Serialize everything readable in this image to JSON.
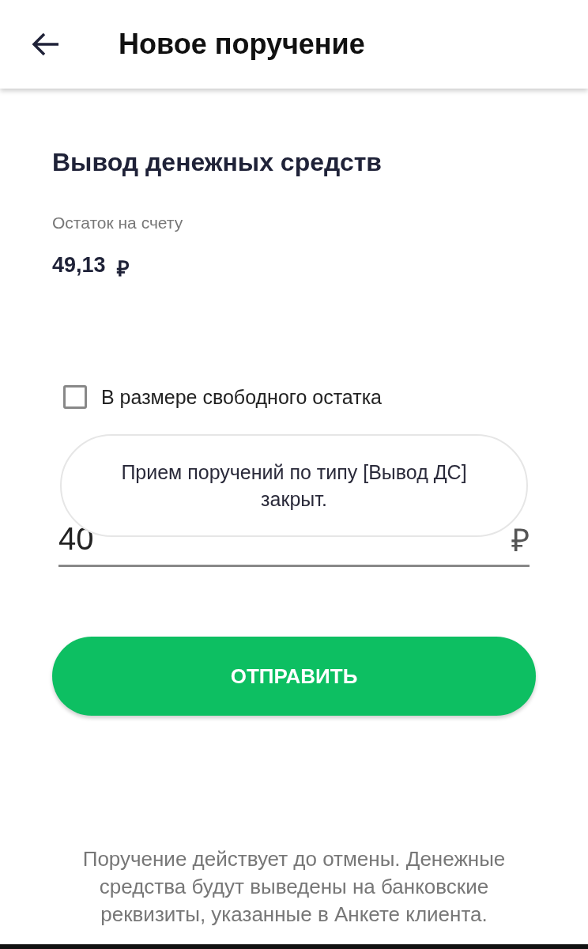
{
  "header": {
    "title": "Новое поручение"
  },
  "section_title": "Вывод денежных средств",
  "balance": {
    "label": "Остаток на счету",
    "value": "49,13",
    "currency": "₽"
  },
  "checkbox": {
    "label": "В размере свободного остатка",
    "checked": false
  },
  "amount_field": {
    "value": "40",
    "currency": "₽"
  },
  "toast": {
    "message": "Прием поручений по типу [Вывод ДС] закрыт."
  },
  "submit_button": "ОТПРАВИТЬ",
  "footer_note": "Поручение действует до отмены. Денежные средства будут выведены на банковские реквизиты, указанные в Анкете клиента."
}
